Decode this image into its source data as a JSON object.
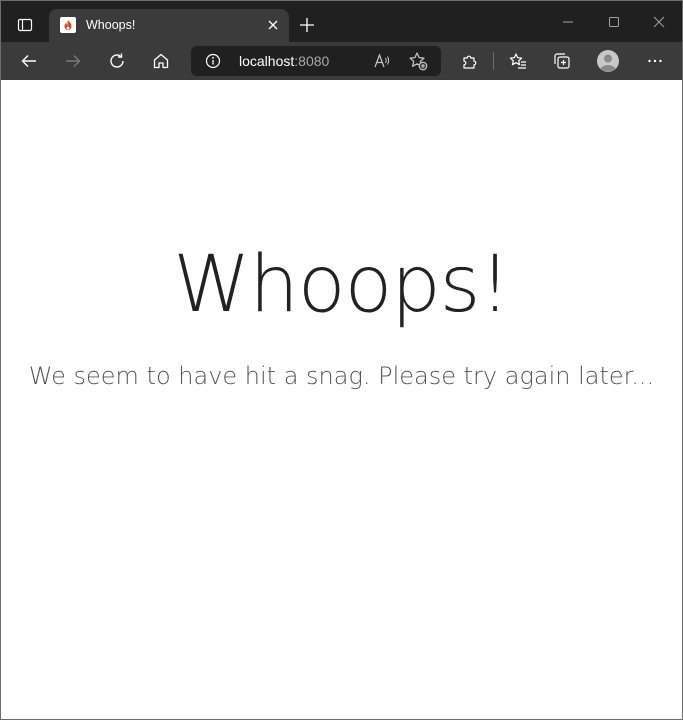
{
  "browser": {
    "tab": {
      "title": "Whoops!",
      "favicon": "flame-icon"
    },
    "address": {
      "host": "localhost",
      "port": ":8080"
    },
    "colors": {
      "tabstrip": "#202020",
      "toolbar": "#3b3b3b",
      "favicon_accent": "#dd4814"
    }
  },
  "page": {
    "headline": "Whoops!",
    "message": "We seem to have hit a snag. Please try again later..."
  }
}
